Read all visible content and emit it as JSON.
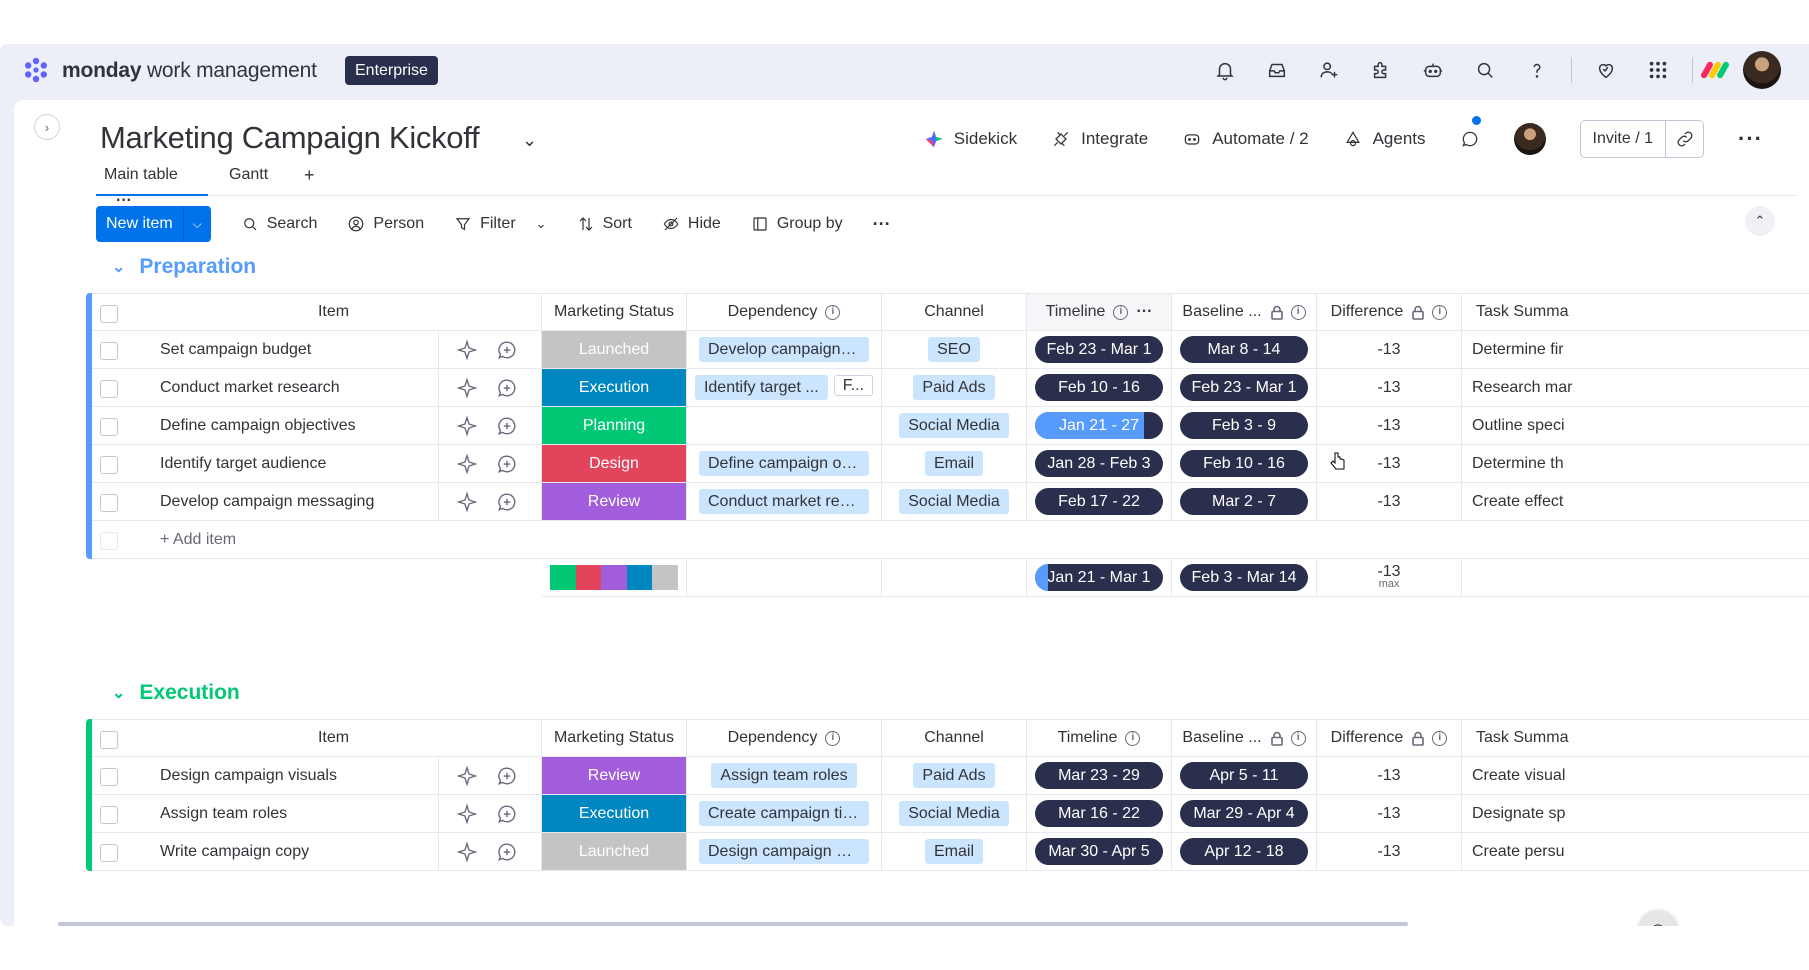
{
  "topbar": {
    "brand_bold": "monday",
    "brand_rest": " work management",
    "plan_badge": "Enterprise",
    "icons": [
      "bell-icon",
      "inbox-icon",
      "invite-user-icon",
      "apps-icon",
      "ai-bot-icon",
      "search-icon",
      "help-icon",
      "heart-icon",
      "grid-icon"
    ]
  },
  "board": {
    "title": "Marketing Campaign Kickoff",
    "actions": {
      "sidekick": "Sidekick",
      "integrate": "Integrate",
      "automate": "Automate / 2",
      "agents": "Agents",
      "invite": "Invite / 1"
    },
    "tabs": [
      "Main table",
      "Gantt",
      "+"
    ],
    "toolbar": {
      "new_item": "New item",
      "search": "Search",
      "person": "Person",
      "filter": "Filter",
      "sort": "Sort",
      "hide": "Hide",
      "group_by": "Group by"
    }
  },
  "columns": [
    "Item",
    "Marketing Status",
    "Dependency",
    "Channel",
    "Timeline",
    "Baseline ...",
    "Difference",
    "Task Summa"
  ],
  "colors": {
    "Launched": "#c4c4c4",
    "Execution": "#0086c0",
    "Planning": "#00c875",
    "Design": "#e2445c",
    "Review": "#a25ddc",
    "preparation_group": "#579bfc",
    "execution_group": "#00c875"
  },
  "groups": [
    {
      "name": "Preparation",
      "color": "#579bfc",
      "rows": [
        {
          "item": "Set campaign budget",
          "status": "Launched",
          "dependency": [
            "Develop campaign m..."
          ],
          "channel": "SEO",
          "timeline": "Feb 23 - Mar 1",
          "baseline": "Mar 8 - 14",
          "difference": "-13",
          "summary": "Determine fir"
        },
        {
          "item": "Conduct market research",
          "status": "Execution",
          "dependency": [
            "Identify target ...",
            "F..."
          ],
          "channel": "Paid Ads",
          "timeline": "Feb 10 - 16",
          "baseline": "Feb 23 - Mar 1",
          "difference": "-13",
          "summary": "Research mar"
        },
        {
          "item": "Define campaign objectives",
          "status": "Planning",
          "dependency": [],
          "channel": "Social Media",
          "timeline": "Jan 21 - 27",
          "timeline_progress": 0.85,
          "baseline": "Feb 3 - 9",
          "difference": "-13",
          "summary": "Outline speci"
        },
        {
          "item": "Identify target audience",
          "status": "Design",
          "dependency": [
            "Define campaign obj..."
          ],
          "channel": "Email",
          "timeline": "Jan 28 - Feb 3",
          "baseline": "Feb 10 - 16",
          "difference": "-13",
          "summary": "Determine th"
        },
        {
          "item": "Develop campaign messaging",
          "status": "Review",
          "dependency": [
            "Conduct market rese..."
          ],
          "channel": "Social Media",
          "timeline": "Feb 17 - 22",
          "baseline": "Mar 2 - 7",
          "difference": "-13",
          "summary": "Create effect"
        }
      ],
      "add_item": "+ Add item",
      "summary": {
        "timeline": "Jan 21 - Mar 1",
        "timeline_progress": 0.1,
        "baseline": "Feb 3 - Mar 14",
        "difference": "-13",
        "difference_label": "max",
        "status_mix": [
          "Planning",
          "Design",
          "Review",
          "Execution",
          "Launched"
        ]
      }
    },
    {
      "name": "Execution",
      "color": "#00c875",
      "rows": [
        {
          "item": "Design campaign visuals",
          "status": "Review",
          "dependency": [
            "Assign team roles"
          ],
          "channel": "Paid Ads",
          "timeline": "Mar 23 - 29",
          "baseline": "Apr 5 - 11",
          "difference": "-13",
          "summary": "Create visual"
        },
        {
          "item": "Assign team roles",
          "status": "Execution",
          "dependency": [
            "Create campaign tim..."
          ],
          "channel": "Social Media",
          "timeline": "Mar 16 - 22",
          "baseline": "Mar 29 - Apr 4",
          "difference": "-13",
          "summary": "Designate sp"
        },
        {
          "item": "Write campaign copy",
          "status": "Launched",
          "dependency": [
            "Design campaign visu..."
          ],
          "channel": "Email",
          "timeline": "Mar 30 - Apr 5",
          "baseline": "Apr 12 - 18",
          "difference": "-13",
          "summary": "Create persu"
        }
      ]
    }
  ]
}
